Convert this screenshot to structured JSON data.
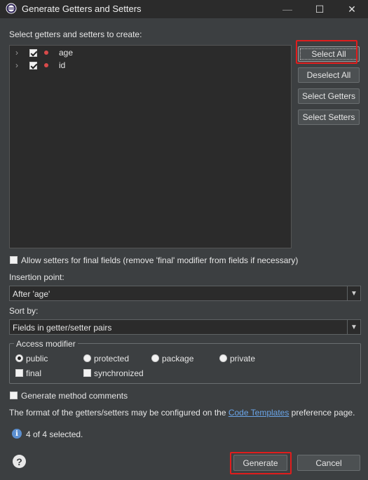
{
  "window": {
    "title": "Generate Getters and Setters",
    "minimize": "—",
    "maximize": "☐",
    "close": "✕"
  },
  "instruction": "Select getters and setters to create:",
  "fields": [
    {
      "name": "age",
      "checked": true
    },
    {
      "name": "id",
      "checked": true
    }
  ],
  "side_buttons": {
    "select_all": "Select All",
    "deselect_all": "Deselect All",
    "select_getters": "Select Getters",
    "select_setters": "Select Setters"
  },
  "allow_setters_final": {
    "label": "Allow setters for final fields (remove 'final' modifier from fields if necessary)",
    "checked": false
  },
  "insertion_point": {
    "label": "Insertion point:",
    "value": "After 'age'"
  },
  "sort_by": {
    "label": "Sort by:",
    "value": "Fields in getter/setter pairs"
  },
  "access_modifier": {
    "title": "Access modifier",
    "radios": [
      {
        "label": "public",
        "checked": true
      },
      {
        "label": "protected",
        "checked": false
      },
      {
        "label": "package",
        "checked": false
      },
      {
        "label": "private",
        "checked": false
      }
    ],
    "final": {
      "label": "final",
      "checked": false
    },
    "synchronized": {
      "label": "synchronized",
      "checked": false
    }
  },
  "generate_comments": {
    "label": "Generate method comments",
    "checked": false
  },
  "format_note": {
    "prefix": "The format of the getters/setters may be configured on the ",
    "link": "Code Templates",
    "suffix": " preference page."
  },
  "status": "4 of 4 selected.",
  "buttons": {
    "generate": "Generate",
    "cancel": "Cancel"
  },
  "colors": {
    "background": "#3c3f41",
    "highlight": "#e01d1d",
    "link": "#6aa5e8"
  }
}
